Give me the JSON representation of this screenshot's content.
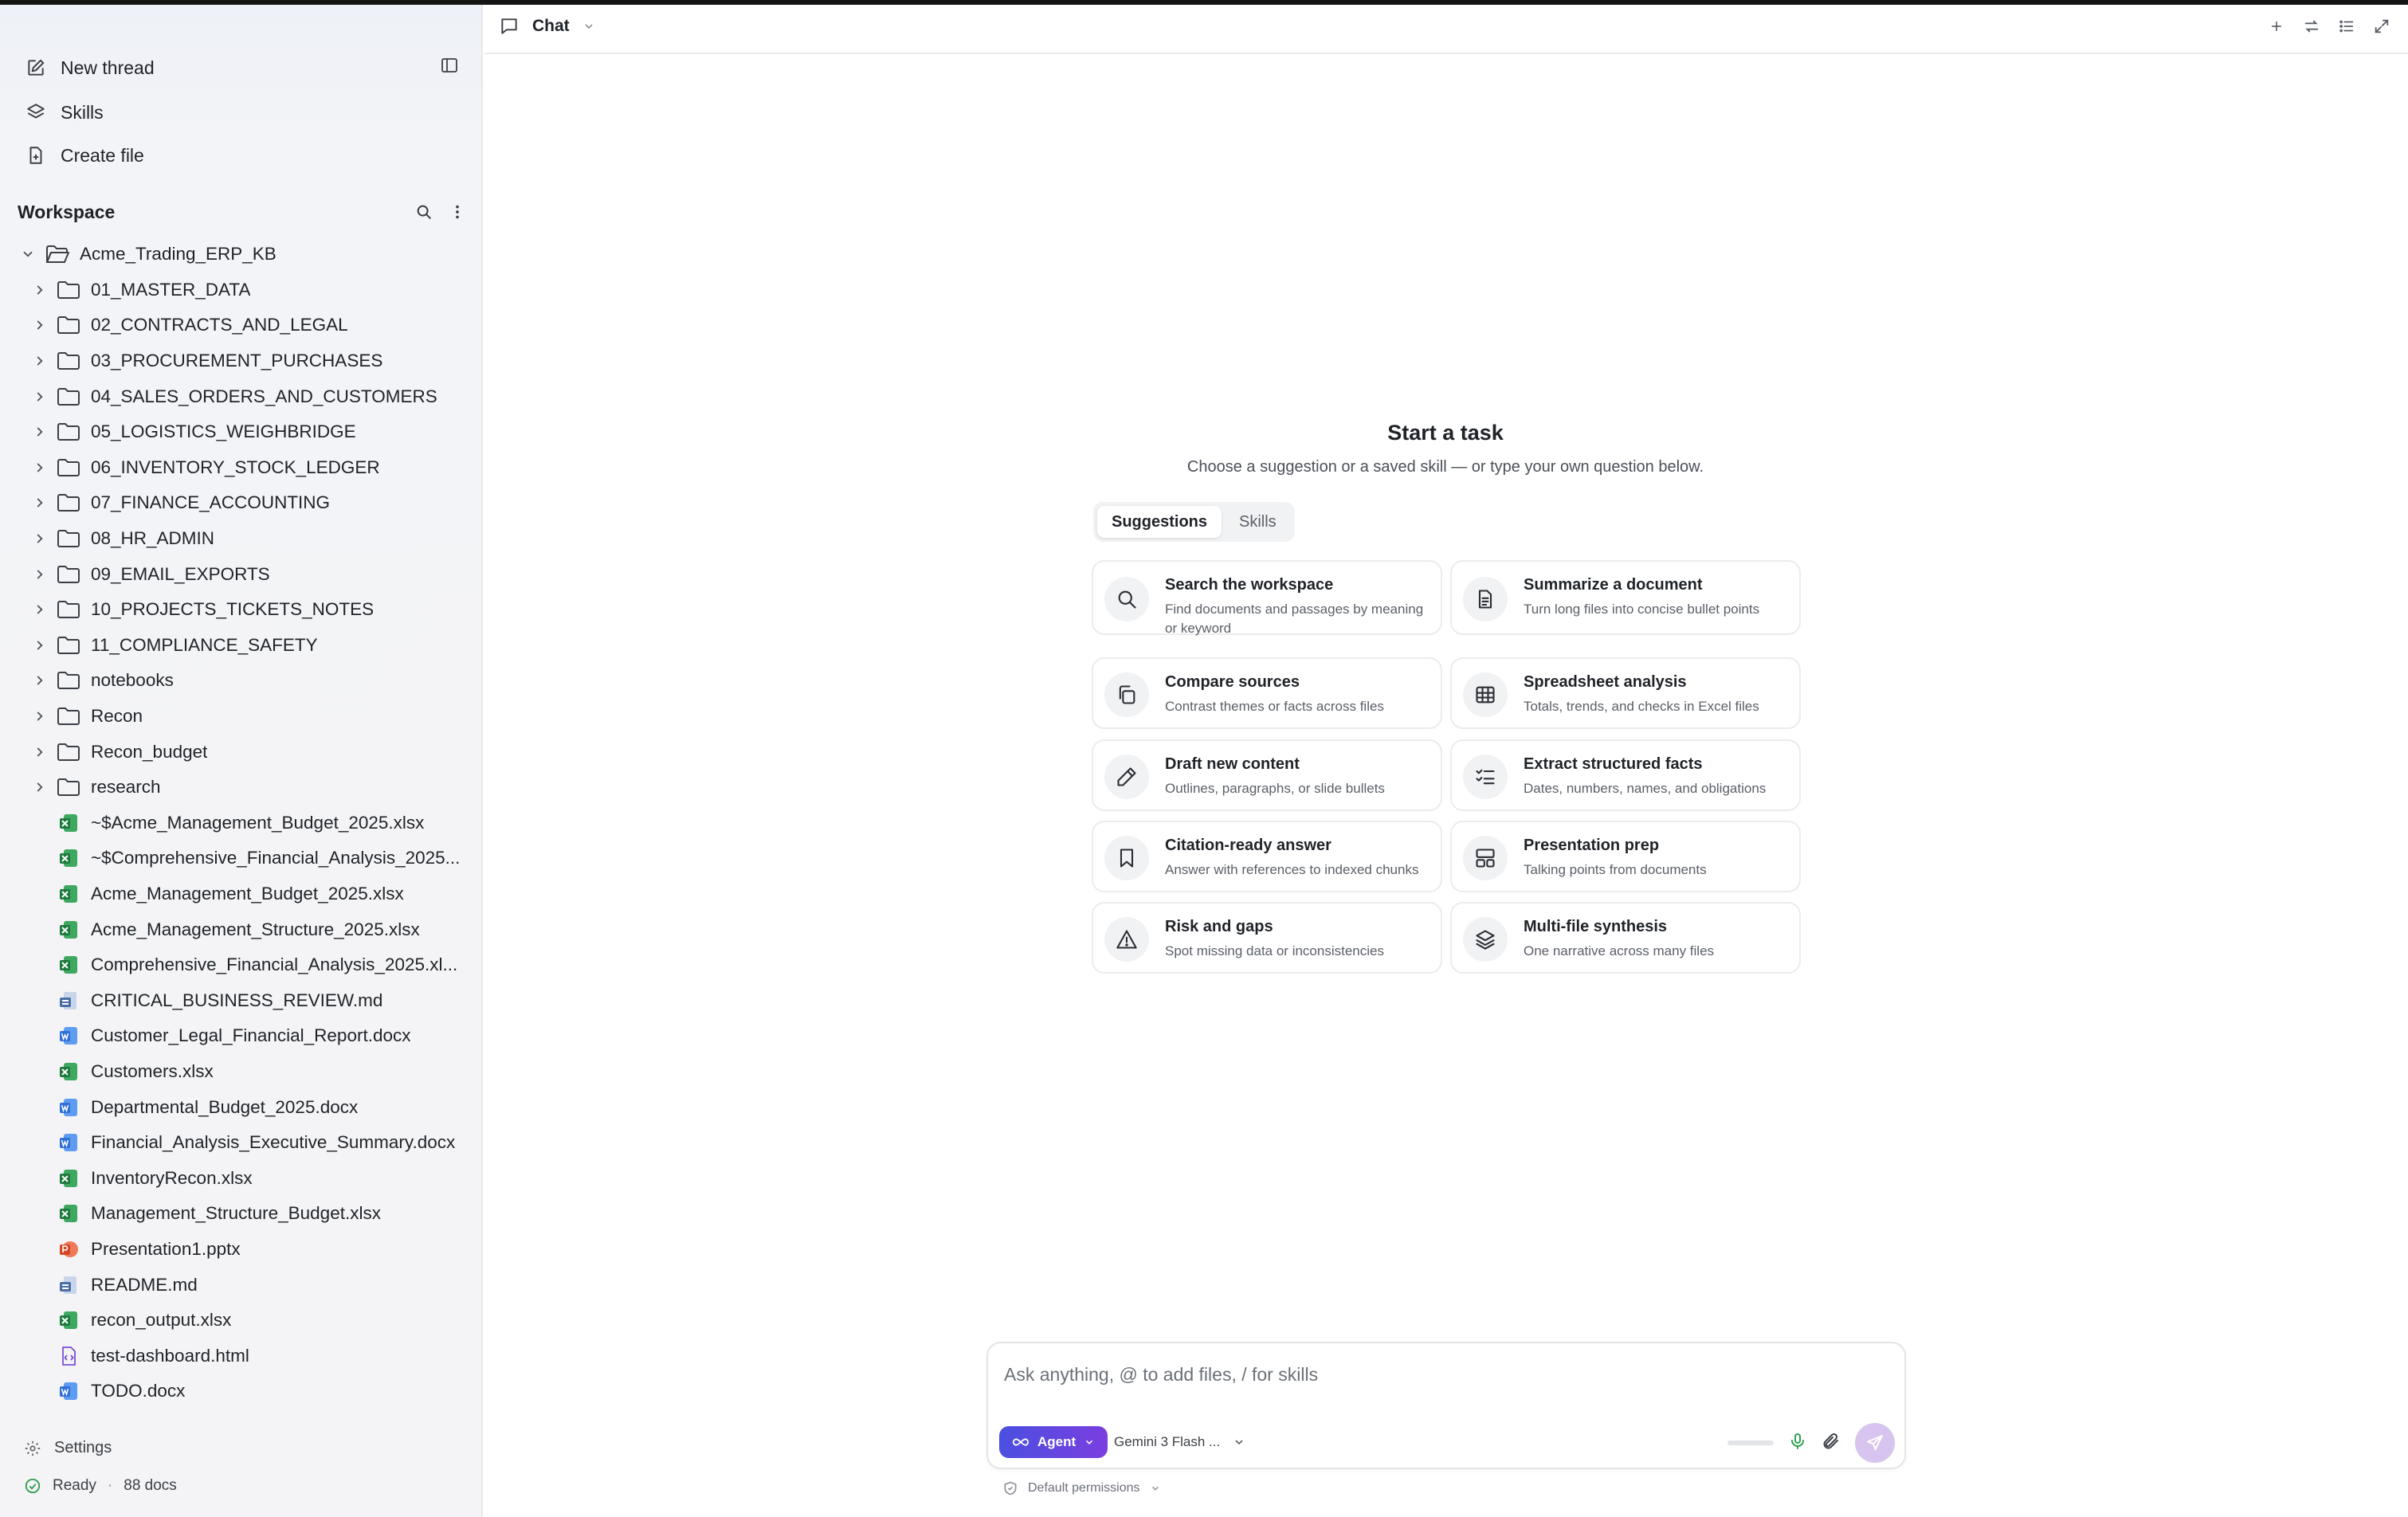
{
  "sidebar": {
    "new_thread": "New thread",
    "skills": "Skills",
    "create_file": "Create file",
    "workspace_title": "Workspace",
    "root_folder": "Acme_Trading_ERP_KB",
    "folders": [
      "01_MASTER_DATA",
      "02_CONTRACTS_AND_LEGAL",
      "03_PROCUREMENT_PURCHASES",
      "04_SALES_ORDERS_AND_CUSTOMERS",
      "05_LOGISTICS_WEIGHBRIDGE",
      "06_INVENTORY_STOCK_LEDGER",
      "07_FINANCE_ACCOUNTING",
      "08_HR_ADMIN",
      "09_EMAIL_EXPORTS",
      "10_PROJECTS_TICKETS_NOTES",
      "11_COMPLIANCE_SAFETY",
      "notebooks",
      "Recon",
      "Recon_budget",
      "research"
    ],
    "files": [
      {
        "name": "~$Acme_Management_Budget_2025.xlsx",
        "type": "xlsx"
      },
      {
        "name": "~$Comprehensive_Financial_Analysis_2025...",
        "type": "xlsx"
      },
      {
        "name": "Acme_Management_Budget_2025.xlsx",
        "type": "xlsx"
      },
      {
        "name": "Acme_Management_Structure_2025.xlsx",
        "type": "xlsx"
      },
      {
        "name": "Comprehensive_Financial_Analysis_2025.xl...",
        "type": "xlsx"
      },
      {
        "name": "CRITICAL_BUSINESS_REVIEW.md",
        "type": "md"
      },
      {
        "name": "Customer_Legal_Financial_Report.docx",
        "type": "docx"
      },
      {
        "name": "Customers.xlsx",
        "type": "xlsx"
      },
      {
        "name": "Departmental_Budget_2025.docx",
        "type": "docx"
      },
      {
        "name": "Financial_Analysis_Executive_Summary.docx",
        "type": "docx"
      },
      {
        "name": "InventoryRecon.xlsx",
        "type": "xlsx"
      },
      {
        "name": "Management_Structure_Budget.xlsx",
        "type": "xlsx"
      },
      {
        "name": "Presentation1.pptx",
        "type": "pptx"
      },
      {
        "name": "README.md",
        "type": "md"
      },
      {
        "name": "recon_output.xlsx",
        "type": "xlsx"
      },
      {
        "name": "test-dashboard.html",
        "type": "html"
      },
      {
        "name": "TODO.docx",
        "type": "docx"
      }
    ],
    "settings": "Settings",
    "status": "Ready",
    "doc_count": "88 docs"
  },
  "header": {
    "tab_label": "Chat"
  },
  "hero": {
    "title": "Start a task",
    "subtitle": "Choose a suggestion or a saved skill — or type your own question below."
  },
  "tabs": {
    "suggestions": "Suggestions",
    "skills": "Skills"
  },
  "cards": [
    {
      "title": "Search the workspace",
      "desc": "Find documents and passages by meaning or keyword",
      "icon": "search-icon"
    },
    {
      "title": "Summarize a document",
      "desc": "Turn long files into concise bullet points",
      "icon": "document-icon"
    },
    {
      "title": "Compare sources",
      "desc": "Contrast themes or facts across files",
      "icon": "copy-icon"
    },
    {
      "title": "Spreadsheet analysis",
      "desc": "Totals, trends, and checks in Excel files",
      "icon": "table-icon"
    },
    {
      "title": "Draft new content",
      "desc": "Outlines, paragraphs, or slide bullets",
      "icon": "pencil-icon"
    },
    {
      "title": "Extract structured facts",
      "desc": "Dates, numbers, names, and obligations",
      "icon": "checklist-icon"
    },
    {
      "title": "Citation-ready answer",
      "desc": "Answer with references to indexed chunks",
      "icon": "bookmark-icon"
    },
    {
      "title": "Presentation prep",
      "desc": "Talking points from documents",
      "icon": "layout-icon"
    },
    {
      "title": "Risk and gaps",
      "desc": "Spot missing data or inconsistencies",
      "icon": "warning-icon"
    },
    {
      "title": "Multi-file synthesis",
      "desc": "One narrative across many files",
      "icon": "layers-icon"
    }
  ],
  "composer": {
    "placeholder": "Ask anything, @ to add files, / for skills",
    "agent_label": "Agent",
    "model_label": "Gemini 3 Flash ...",
    "permissions": "Default permissions"
  },
  "colors": {
    "accent_start": "#4b4fe0",
    "accent_end": "#7a3fe0",
    "xlsx": "#1e7a3c",
    "docx": "#2f6fd6",
    "pptx": "#d24726",
    "md": "#4a6fa5",
    "html": "#7a4fd6",
    "ready": "#2e9e4f"
  }
}
